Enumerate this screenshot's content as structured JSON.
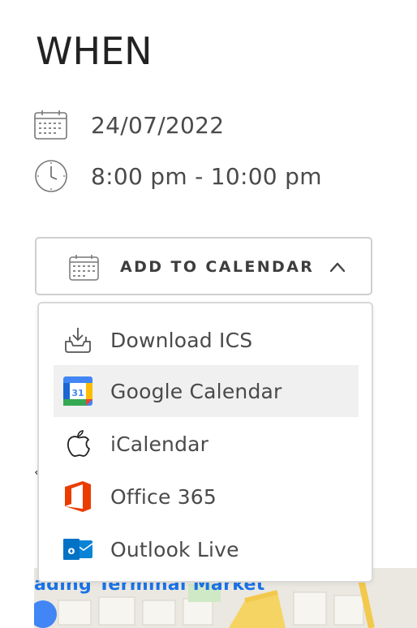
{
  "section": {
    "heading": "WHEN"
  },
  "event": {
    "date": "24/07/2022",
    "time": "8:00 pm - 10:00 pm"
  },
  "add_to_calendar": {
    "label": "ADD TO CALENDAR",
    "expanded": true,
    "options": [
      {
        "label": "Download ICS",
        "icon": "download-tray-icon"
      },
      {
        "label": "Google Calendar",
        "icon": "google-calendar-icon",
        "highlighted": true
      },
      {
        "label": "iCalendar",
        "icon": "apple-icon"
      },
      {
        "label": "Office 365",
        "icon": "office-365-icon"
      },
      {
        "label": "Outlook Live",
        "icon": "outlook-icon"
      }
    ]
  },
  "map": {
    "label": "ading Terminal Market"
  },
  "colors": {
    "google_blue": "#4285f4",
    "office_orange": "#eb3c00",
    "outlook_blue": "#0072c6",
    "hover_bg": "#f0f0f0"
  }
}
